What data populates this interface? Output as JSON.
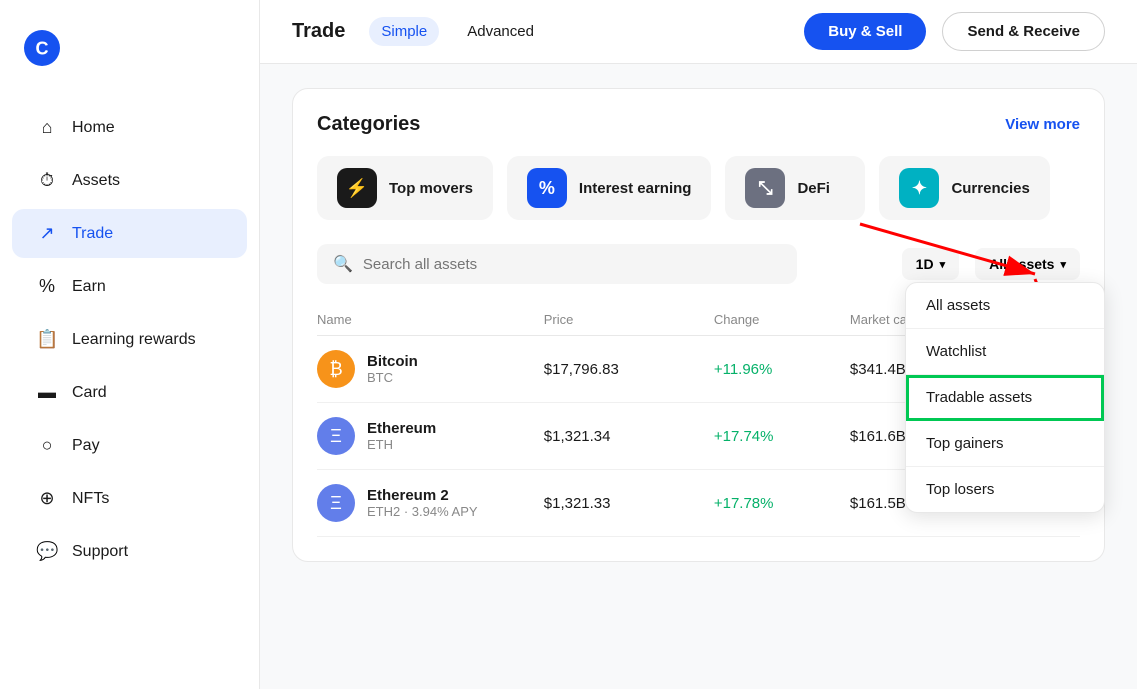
{
  "sidebar": {
    "logo_alt": "Coinbase",
    "items": [
      {
        "id": "home",
        "label": "Home",
        "icon": "⌂"
      },
      {
        "id": "assets",
        "label": "Assets",
        "icon": "⏱"
      },
      {
        "id": "trade",
        "label": "Trade",
        "icon": "↗"
      },
      {
        "id": "earn",
        "label": "Earn",
        "icon": "%"
      },
      {
        "id": "learning",
        "label": "Learning rewards",
        "icon": "📋"
      },
      {
        "id": "card",
        "label": "Card",
        "icon": "▬"
      },
      {
        "id": "pay",
        "label": "Pay",
        "icon": "○"
      },
      {
        "id": "nfts",
        "label": "NFTs",
        "icon": "⊕"
      },
      {
        "id": "support",
        "label": "Support",
        "icon": "💬"
      }
    ]
  },
  "header": {
    "title": "Trade",
    "tab_simple": "Simple",
    "tab_advanced": "Advanced",
    "btn_buy_sell": "Buy & Sell",
    "btn_send_receive": "Send & Receive"
  },
  "categories": {
    "title": "Categories",
    "view_more": "View more",
    "items": [
      {
        "id": "top-movers",
        "label": "Top movers",
        "icon_type": "movers"
      },
      {
        "id": "interest-earning",
        "label": "Interest earning",
        "icon_type": "interest"
      },
      {
        "id": "defi",
        "label": "DeFi",
        "icon_type": "defi"
      },
      {
        "id": "currencies",
        "label": "Currencies",
        "icon_type": "currencies"
      }
    ]
  },
  "search": {
    "placeholder": "Search all assets"
  },
  "filter": {
    "period": "1D",
    "assets_label": "All assets"
  },
  "table": {
    "columns": [
      {
        "id": "name",
        "label": "Name"
      },
      {
        "id": "price",
        "label": "Price"
      },
      {
        "id": "change",
        "label": "Change"
      },
      {
        "id": "market_cap",
        "label": "Market cap ▲"
      }
    ],
    "rows": [
      {
        "name": "Bitcoin",
        "ticker": "BTC",
        "price": "$17,796.83",
        "change": "+11.96%",
        "market_cap": "$341.4B",
        "icon_color": "#f7931a",
        "icon_symbol": "₿"
      },
      {
        "name": "Ethereum",
        "ticker": "ETH",
        "price": "$1,321.34",
        "change": "+17.74%",
        "market_cap": "$161.6B",
        "icon_color": "#627eea",
        "icon_symbol": "Ξ"
      },
      {
        "name": "Ethereum 2",
        "ticker": "ETH2 · 3.94% APY",
        "price": "$1,321.33",
        "change": "+17.78%",
        "market_cap": "$161.5B",
        "icon_color": "#627eea",
        "icon_symbol": "Ξ"
      }
    ]
  },
  "dropdown": {
    "items": [
      {
        "id": "all-assets",
        "label": "All assets",
        "highlighted": false
      },
      {
        "id": "watchlist",
        "label": "Watchlist",
        "highlighted": false
      },
      {
        "id": "tradable-assets",
        "label": "Tradable assets",
        "highlighted": true
      },
      {
        "id": "top-gainers",
        "label": "Top gainers",
        "highlighted": false
      },
      {
        "id": "top-losers",
        "label": "Top losers",
        "highlighted": false
      }
    ]
  }
}
